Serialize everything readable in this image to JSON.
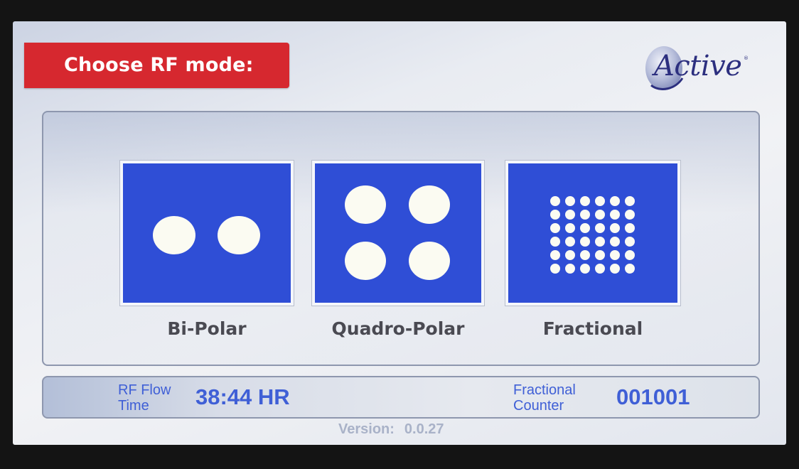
{
  "header": {
    "title": "Choose RF mode:",
    "title_bg_color": "#d6282f"
  },
  "logo": {
    "text": "Active",
    "registered_mark": "®",
    "color": "#2c2f7f"
  },
  "modes": [
    {
      "label": "Bi-Polar",
      "icon": "two-electrode-icon",
      "electrode_count": 2
    },
    {
      "label": "Quadro-Polar",
      "icon": "four-electrode-icon",
      "electrode_count": 4
    },
    {
      "label": "Fractional",
      "icon": "dot-matrix-icon",
      "electrode_count": 36
    }
  ],
  "tile_color": "#2f4ed6",
  "status": {
    "rf_flow_label_line1": "RF Flow",
    "rf_flow_label_line2": "Time",
    "rf_flow_value": "38:44 HR",
    "fractional_label_line1": "Fractional",
    "fractional_label_line2": "Counter",
    "fractional_value": "001001",
    "text_color": "#3f5fd6"
  },
  "version": {
    "label": "Version:",
    "value": "0.0.27"
  }
}
